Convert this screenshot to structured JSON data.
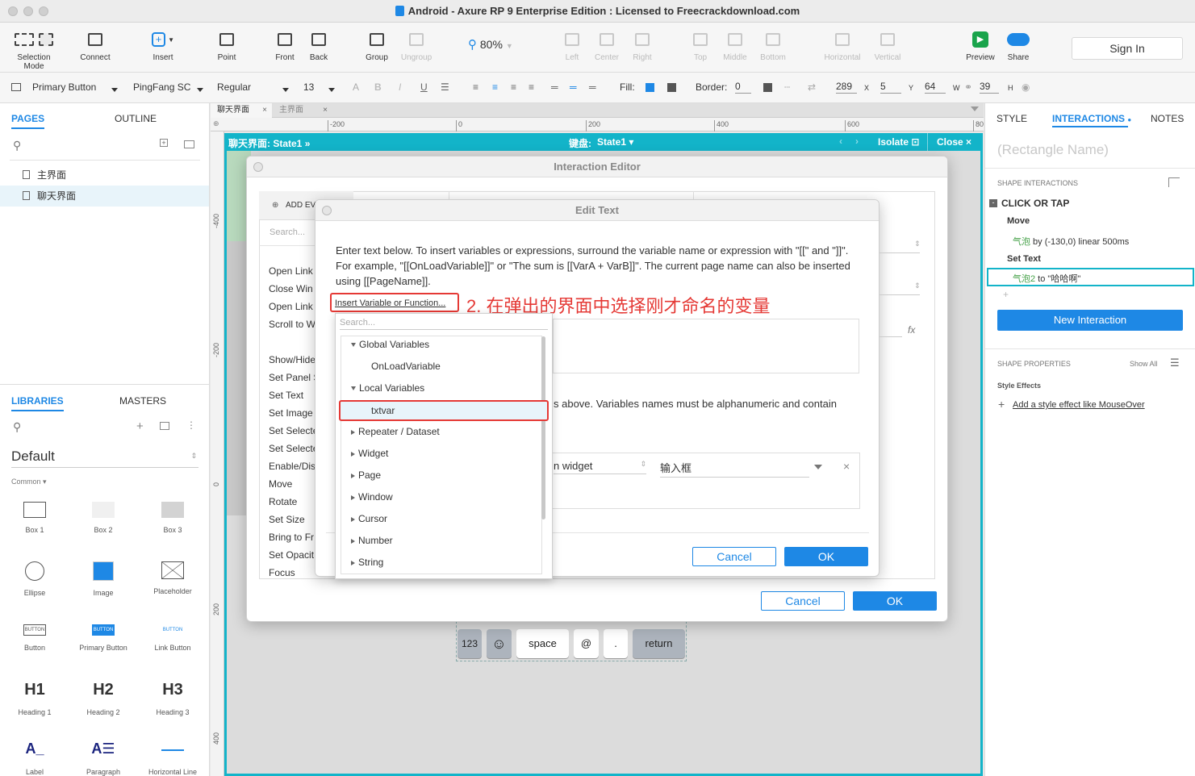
{
  "window": {
    "title": "Android - Axure RP 9 Enterprise Edition : Licensed to Freecrackdownload.com"
  },
  "toolbar": {
    "items": [
      {
        "label": "Selection Mode",
        "icon": "selection-mode-icon"
      },
      {
        "label": "Connect",
        "icon": "connect-icon"
      },
      {
        "label": "Insert",
        "icon": "insert-icon"
      },
      {
        "label": "Point",
        "icon": "point-icon"
      },
      {
        "label": "Front",
        "icon": "front-icon"
      },
      {
        "label": "Back",
        "icon": "back-icon"
      },
      {
        "label": "Group",
        "icon": "group-icon"
      },
      {
        "label": "Ungroup",
        "icon": "ungroup-icon"
      },
      {
        "label": "Left",
        "icon": "align-left-icon"
      },
      {
        "label": "Center",
        "icon": "align-center-icon"
      },
      {
        "label": "Right",
        "icon": "align-right-icon"
      },
      {
        "label": "Top",
        "icon": "align-top-icon"
      },
      {
        "label": "Middle",
        "icon": "align-middle-icon"
      },
      {
        "label": "Bottom",
        "icon": "align-bottom-icon"
      },
      {
        "label": "Horizontal",
        "icon": "distribute-horizontal-icon"
      },
      {
        "label": "Vertical",
        "icon": "distribute-vertical-icon"
      },
      {
        "label": "Preview",
        "icon": "preview-icon"
      },
      {
        "label": "Share",
        "icon": "share-icon"
      }
    ],
    "zoom": "80%",
    "sign_in": "Sign In"
  },
  "format": {
    "style": "Primary Button",
    "font": "PingFang SC",
    "weight": "Regular",
    "size": "13",
    "fill_label": "Fill:",
    "border_label": "Border:",
    "border_value": "0",
    "x": "289",
    "x_label": "X",
    "y": "5",
    "y_label": "Y",
    "w": "64",
    "w_label": "W",
    "h": "39",
    "h_label": "H",
    "fill_color": "#1e88e5"
  },
  "left": {
    "pages_tab": "PAGES",
    "outline_tab": "OUTLINE",
    "pages": [
      "主界面",
      "聊天界面"
    ],
    "libraries_tab": "LIBRARIES",
    "masters_tab": "MASTERS",
    "library_name": "Default",
    "common_label": "Common ▾",
    "widgets": [
      "Box 1",
      "Box 2",
      "Box 3",
      "Ellipse",
      "Image",
      "Placeholder",
      "Button",
      "Primary Button",
      "Link Button",
      "Heading 1",
      "Heading 2",
      "Heading 3",
      "Label",
      "Paragraph",
      "Horizontal Line"
    ],
    "widget_glyphs": {
      "button": "BUTTON",
      "h1": "H1",
      "h2": "H2",
      "h3": "H3",
      "label": "A_",
      "para": "A☰"
    }
  },
  "canvas": {
    "file_tabs": [
      "聊天界面",
      "主界面"
    ],
    "ruler_h": [
      "-200",
      "0",
      "200",
      "400",
      "600",
      "80"
    ],
    "ruler_v": [
      "-400",
      "-200",
      "0",
      "200",
      "400"
    ],
    "state_path": "聊天界面: State1",
    "state_mid": "键盘:",
    "state_mid_value": "State1",
    "isolate": "Isolate",
    "close": "Close"
  },
  "interaction_editor": {
    "title": "Interaction Editor",
    "add_event": "ADD EV",
    "search": "Search...",
    "actions": [
      "Open Link",
      "Close Win",
      "Open Link",
      "Scroll to W",
      "Show/Hide",
      "Set Panel S",
      "Set Text",
      "Set Image",
      "Set Selecte",
      "Set Selecte",
      "Enable/Dis",
      "Move",
      "Rotate",
      "Set Size",
      "Bring to Fr",
      "Set Opacit",
      "Focus"
    ],
    "cancel": "Cancel",
    "ok": "OK"
  },
  "edit_text": {
    "title": "Edit Text",
    "description": "Enter text below. To insert variables or expressions, surround the variable name or expression with \"[[\" and \"]]\". For example, \"[[OnLoadVariable]]\" or \"The sum is [[VarA + VarB]]\". The current page name can also be inserted using [[PageName]].",
    "insert_link": "Insert Variable or Function...",
    "annotation": "2. 在弹出的界面中选择刚才命名的变量",
    "partial_text": "s above. Variables names must be alphanumeric and contain",
    "widget_label": "n widget",
    "widget_value": "输入框",
    "cancel": "Cancel",
    "ok": "OK"
  },
  "dropdown": {
    "search": "Search...",
    "tree": [
      {
        "label": "Global Variables",
        "type": "open",
        "level": 0
      },
      {
        "label": "OnLoadVariable",
        "type": "leaf",
        "level": 1
      },
      {
        "label": "Local Variables",
        "type": "open",
        "level": 0
      },
      {
        "label": "txtvar",
        "type": "leaf",
        "level": 1,
        "selected": true
      },
      {
        "label": "Repeater / Dataset",
        "type": "closed",
        "level": 0
      },
      {
        "label": "Widget",
        "type": "closed",
        "level": 0
      },
      {
        "label": "Page",
        "type": "closed",
        "level": 0
      },
      {
        "label": "Window",
        "type": "closed",
        "level": 0
      },
      {
        "label": "Cursor",
        "type": "closed",
        "level": 0
      },
      {
        "label": "Number",
        "type": "closed",
        "level": 0
      },
      {
        "label": "String",
        "type": "closed",
        "level": 0
      }
    ]
  },
  "keyboard": {
    "keys": [
      "123",
      "☺",
      "space",
      "@",
      ".",
      "return"
    ]
  },
  "right": {
    "style_tab": "STYLE",
    "interactions_tab": "INTERACTIONS",
    "notes_tab": "NOTES",
    "name_placeholder": "(Rectangle Name)",
    "shape_interactions": "SHAPE INTERACTIONS",
    "event": "CLICK OR TAP",
    "action1": "Move",
    "action1_target": "气泡",
    "action1_detail": " by (-130,0) linear 500ms",
    "action2": "Set Text",
    "action2_target": "气泡2",
    "action2_detail": " to \"哈哈啊\"",
    "plus": "+",
    "new_interaction": "New Interaction",
    "shape_properties": "SHAPE PROPERTIES",
    "show_all": "Show All",
    "style_effects": "Style Effects",
    "add_effect": "Add a style effect like MouseOver"
  }
}
